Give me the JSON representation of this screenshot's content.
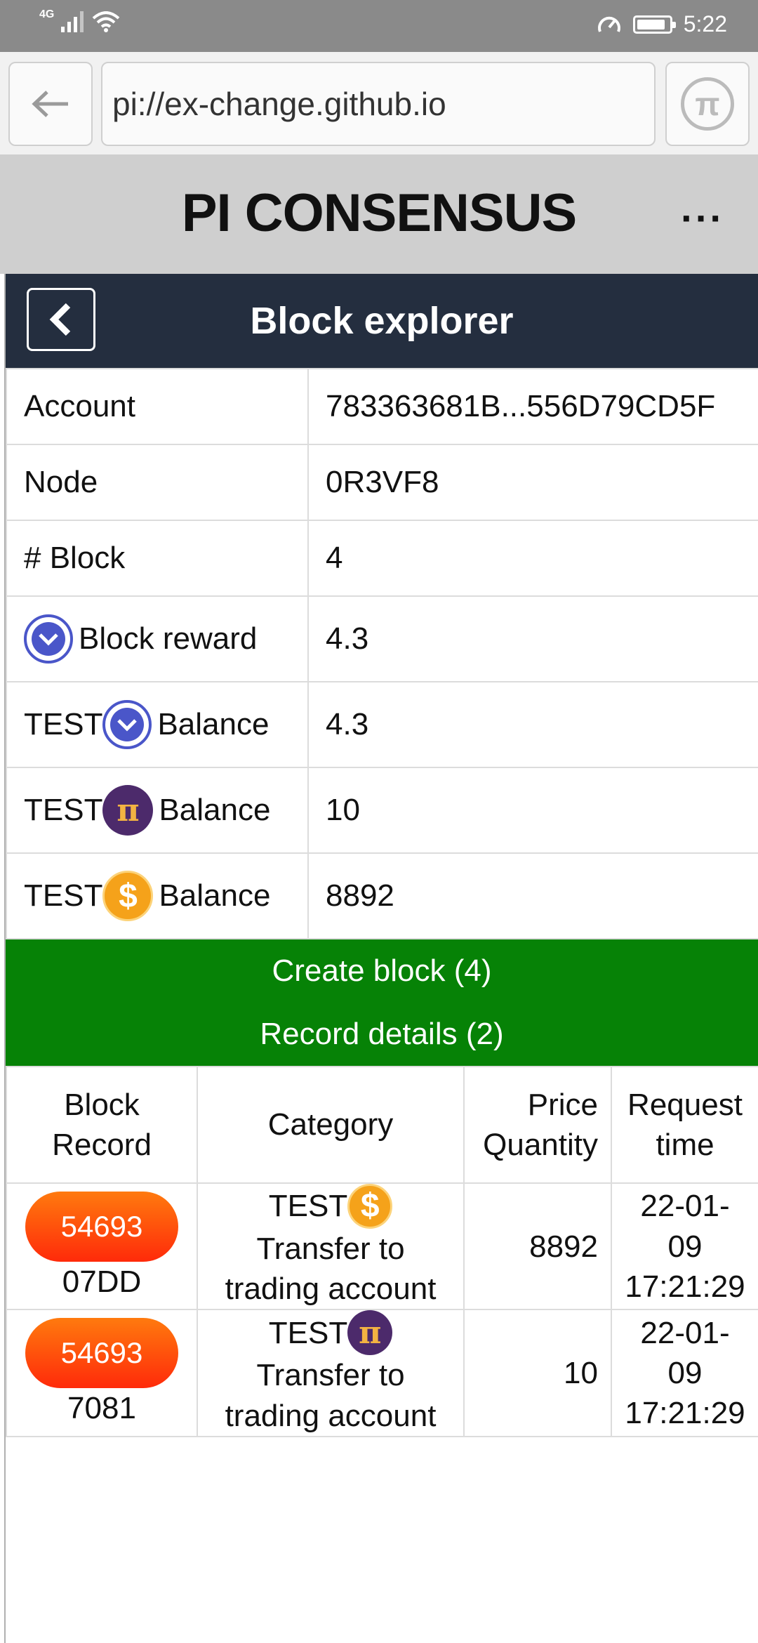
{
  "status_bar": {
    "network": "4G",
    "time": "5:22",
    "battery_level": 0.9
  },
  "browser": {
    "url": "pi://ex-change.github.io"
  },
  "app": {
    "title": "PI CONSENSUS",
    "more_label": "···"
  },
  "explorer": {
    "title": "Block explorer"
  },
  "info": {
    "account_label": "Account",
    "account_value": "783363681B...556D79CD5F",
    "node_label": "Node",
    "node_value": "0R3VF8",
    "block_label": "# Block",
    "block_value": "4",
    "reward_label": "Block reward",
    "reward_value": "4.3",
    "test_prefix": "TEST",
    "balance_label": "Balance",
    "balance_v_value": "4.3",
    "balance_pi_value": "10",
    "balance_usd_value": "8892"
  },
  "actions": {
    "create_block": "Create block (4)",
    "record_details": "Record details (2)"
  },
  "records": {
    "headers": {
      "block_record_1": "Block",
      "block_record_2": "Record",
      "category": "Category",
      "price_1": "Price",
      "price_2": "Quantity",
      "time_1": "Request",
      "time_2": "time"
    },
    "rows": [
      {
        "block": "54693",
        "record": "07DD",
        "category_prefix": "TEST",
        "category_coin": "usd",
        "category_line1": "Transfer to",
        "category_line2": "trading account",
        "quantity": "8892",
        "time_1": "22-01-",
        "time_2": "09",
        "time_3": "17:21:29"
      },
      {
        "block": "54693",
        "record": "7081",
        "category_prefix": "TEST",
        "category_coin": "pi",
        "category_line1": "Transfer to",
        "category_line2": "trading account",
        "quantity": "10",
        "time_1": "22-01-",
        "time_2": "09",
        "time_3": "17:21:29"
      }
    ]
  },
  "icons": {
    "back": "arrow-left-icon",
    "pi_logo": "pi-logo-icon",
    "coin_v": "v-coin-icon",
    "coin_pi": "pi-coin-icon",
    "coin_usd": "dollar-coin-icon"
  },
  "colors": {
    "header_dark": "#242e3f",
    "action_green": "#068206",
    "pill_orange": "#ff5a0e",
    "pi_purple": "#4c2a6b",
    "coin_gold": "#f5a21a",
    "v_blue": "#4a56c9"
  }
}
